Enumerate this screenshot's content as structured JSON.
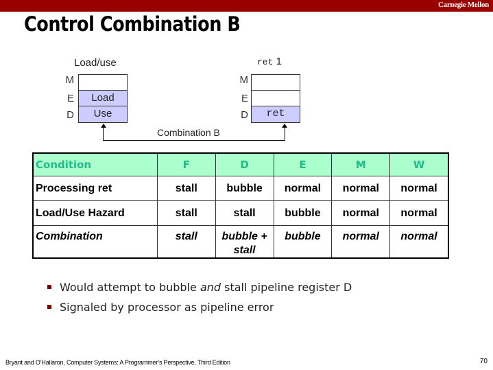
{
  "header": {
    "brand": "Carnegie Mellon",
    "title": "Control Combination B"
  },
  "diagram": {
    "left": {
      "label": "Load/use",
      "stages": [
        "M",
        "E",
        "D"
      ],
      "cells": [
        "",
        "Load",
        "Use"
      ]
    },
    "right": {
      "label_code": "ret",
      "label_num": "1",
      "stages": [
        "M",
        "E",
        "D"
      ],
      "cells": [
        "",
        "",
        "ret"
      ]
    },
    "connector_label": "Combination B",
    "colors": {
      "filled_cell": "#ccccff"
    }
  },
  "table": {
    "headers": [
      "Condition",
      "F",
      "D",
      "E",
      "M",
      "W"
    ],
    "rows": [
      {
        "cells": [
          "Processing ret",
          "stall",
          "bubble",
          "normal",
          "normal",
          "normal"
        ]
      },
      {
        "cells": [
          "Load/Use Hazard",
          "stall",
          "stall",
          "bubble",
          "normal",
          "normal"
        ]
      },
      {
        "cells": [
          "Combination",
          "stall",
          "bubble + stall",
          "bubble",
          "normal",
          "normal"
        ]
      }
    ],
    "colors": {
      "header_bg": "#aaffcc",
      "header_text": "#22bb88"
    }
  },
  "bullets": {
    "items": [
      {
        "pre": "Would attempt to bubble ",
        "em": "and",
        "post": " stall pipeline register D"
      },
      {
        "pre": "Signaled by processor as pipeline error",
        "em": "",
        "post": ""
      }
    ]
  },
  "footer": {
    "citation": "Bryant and O’Hallaron, Computer Systems: A Programmer’s Perspective, Third Edition",
    "page": "70"
  },
  "colors": {
    "brand_bar": "#990000"
  }
}
